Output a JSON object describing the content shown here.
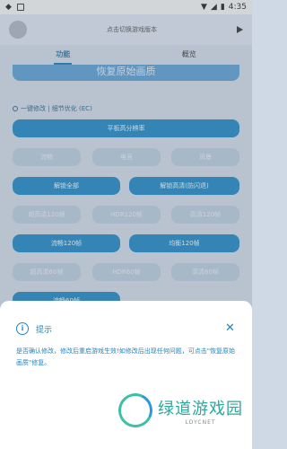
{
  "status": {
    "time": "4:35"
  },
  "topbar": {
    "title": "点击切换游戏版本"
  },
  "tabs": [
    {
      "label": "功能"
    },
    {
      "label": "概览"
    }
  ],
  "content": {
    "restore_label": "恢复原始画质",
    "section_title": "一键修改 | 细节优化 (EC)",
    "buttons": {
      "b1": "平板高分辨率",
      "b2": "流畅",
      "b3": "电竞",
      "b4": "风景",
      "b5": "解锁全部",
      "b6": "解锁高清(防闪退)",
      "b7": "超高清120帧",
      "b8": "HDR120帧",
      "b9": "高清120帧",
      "b10": "流畅120帧",
      "b11": "均衡120帧",
      "b12": "超高清60帧",
      "b13": "HDR60帧",
      "b14": "高清60帧",
      "b15": "流畅60帧"
    }
  },
  "dialog": {
    "title": "提示",
    "message": "是否确认修改，修改后重启游戏生效!如修改后出现任何问题，可点击\"恢复原始画质\"修复。",
    "close_symbol": "✕",
    "info_symbol": "i"
  },
  "watermark": {
    "main": "绿道游戏园",
    "sub": "LDYCNET"
  }
}
